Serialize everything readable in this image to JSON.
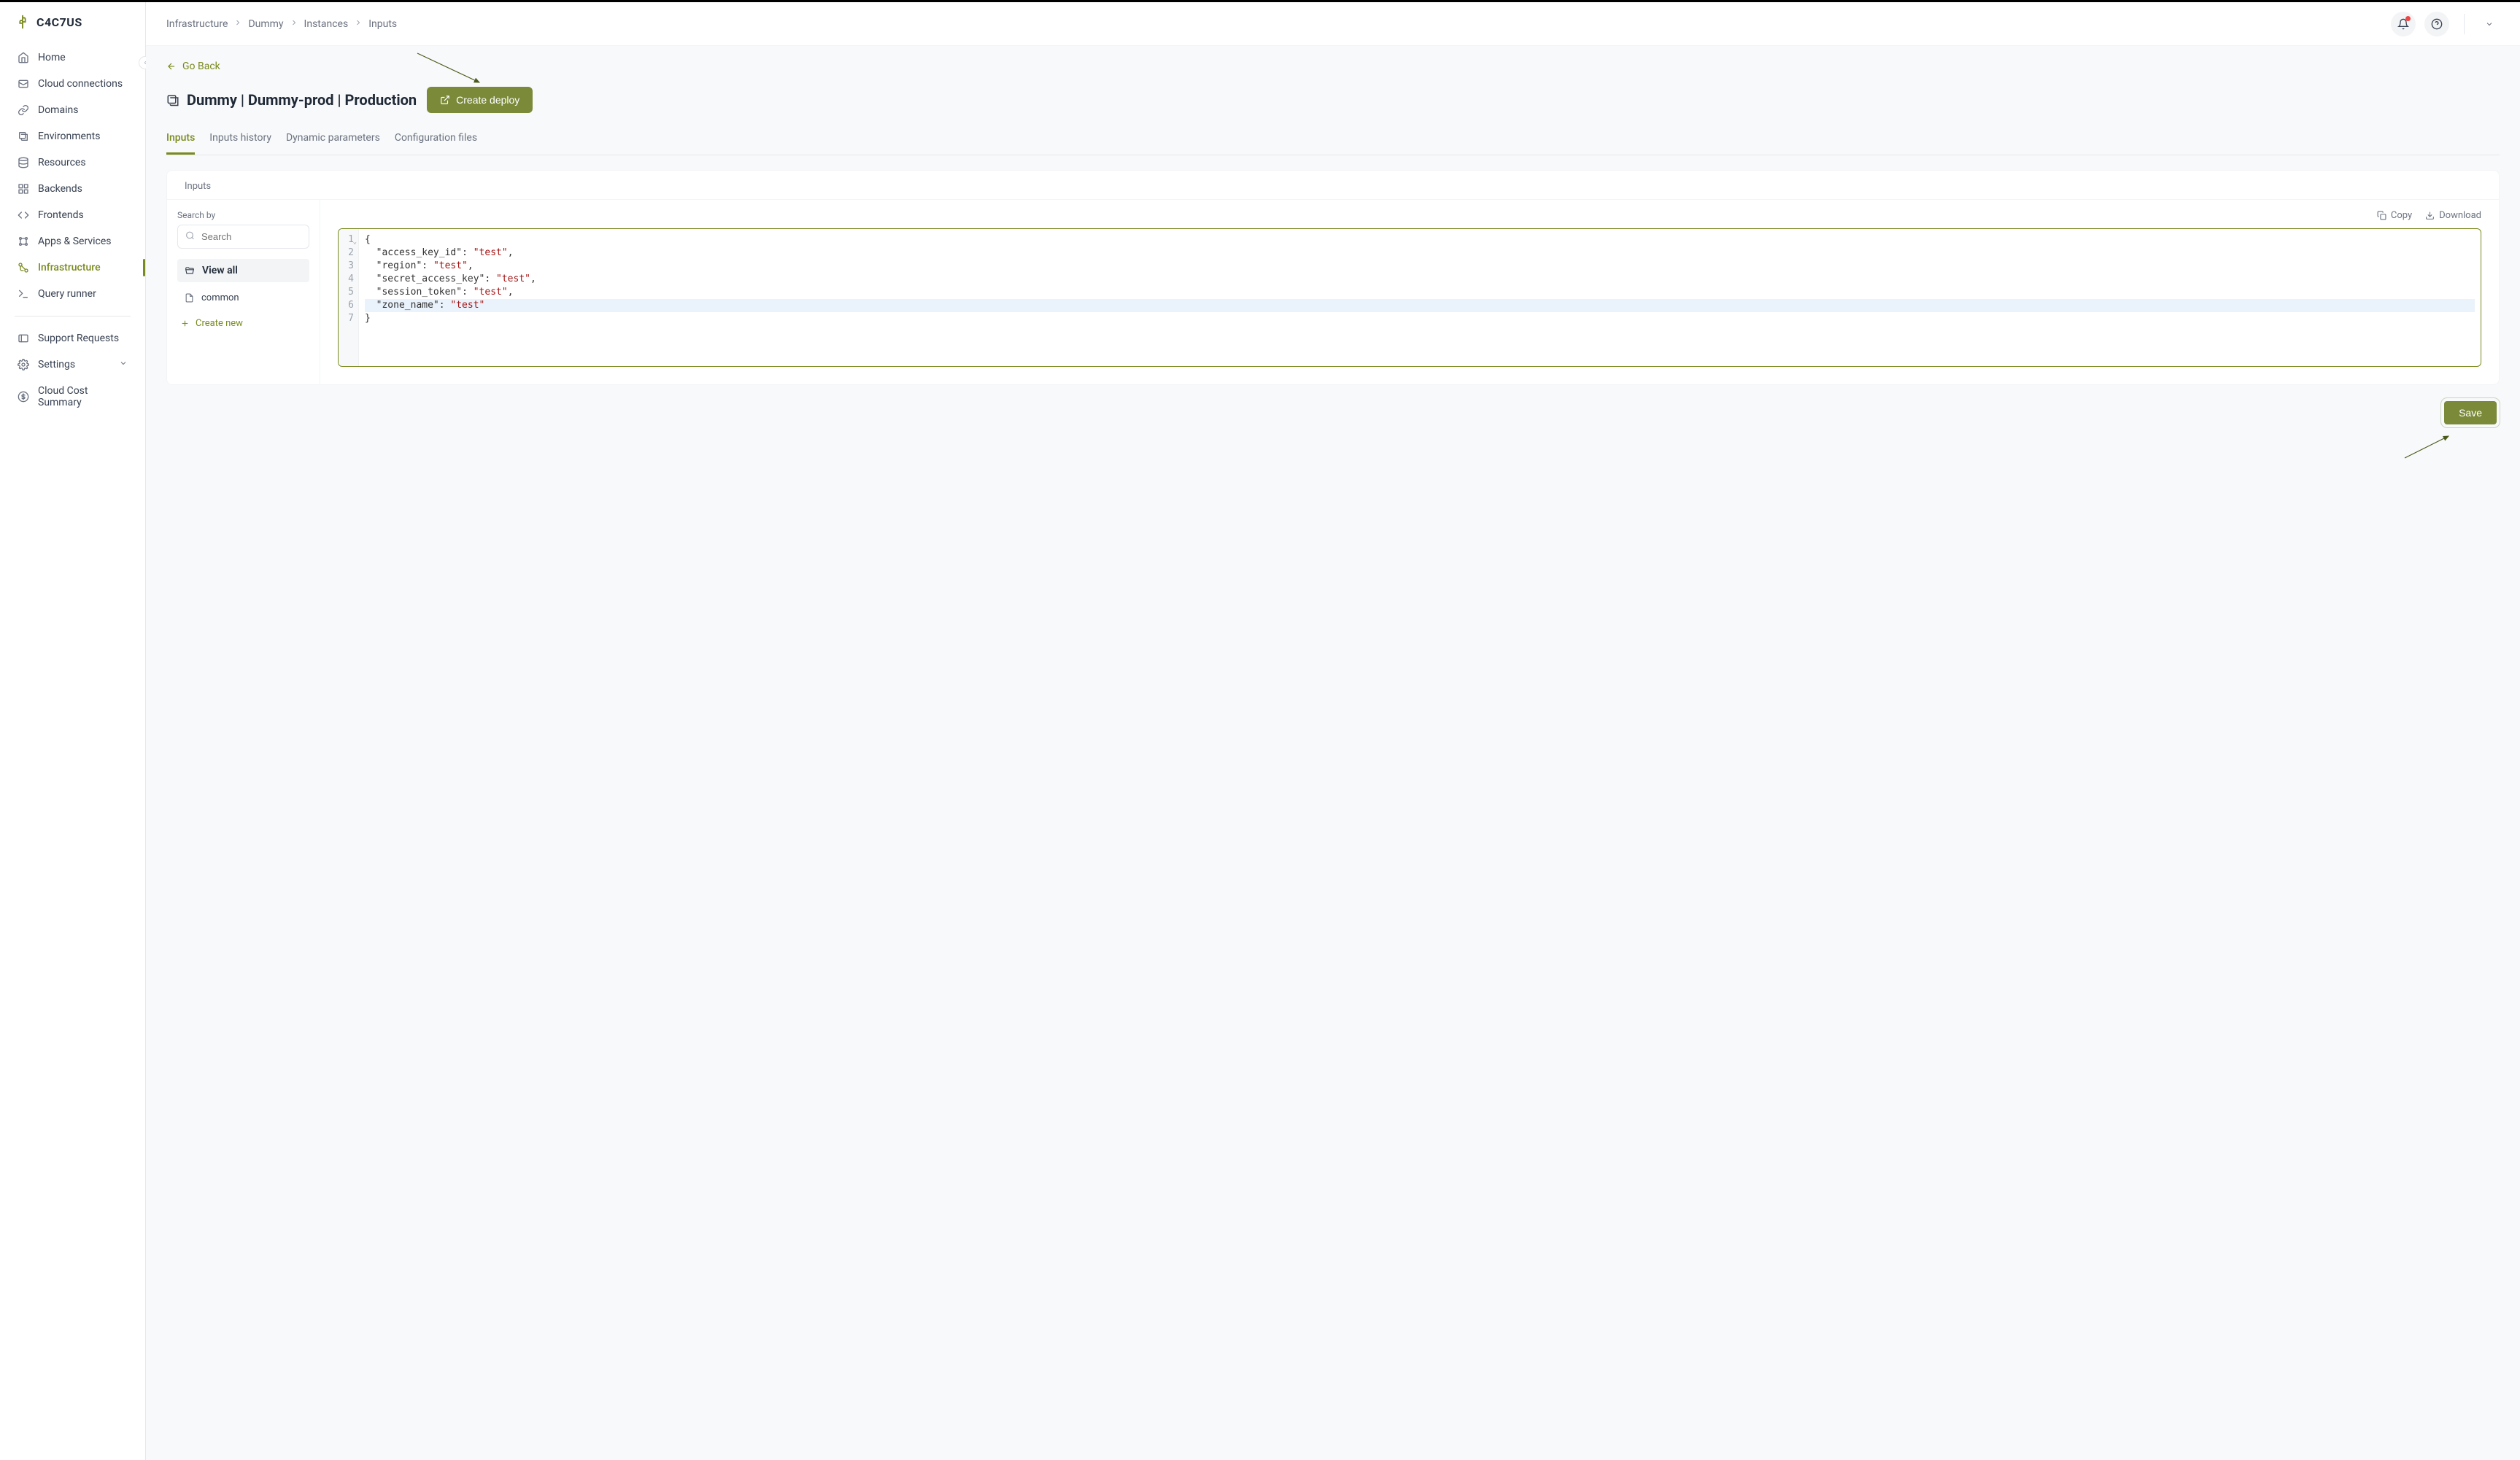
{
  "brand": "C4C7US",
  "sidebar": {
    "items": [
      {
        "label": "Home",
        "icon": "home"
      },
      {
        "label": "Cloud connections",
        "icon": "cloud"
      },
      {
        "label": "Domains",
        "icon": "link"
      },
      {
        "label": "Environments",
        "icon": "layers"
      },
      {
        "label": "Resources",
        "icon": "db"
      },
      {
        "label": "Backends",
        "icon": "grid"
      },
      {
        "label": "Frontends",
        "icon": "code"
      },
      {
        "label": "Apps & Services",
        "icon": "apps"
      },
      {
        "label": "Infrastructure",
        "icon": "infra",
        "active": true
      },
      {
        "label": "Query runner",
        "icon": "terminal"
      }
    ],
    "bottom": [
      {
        "label": "Support Requests",
        "icon": "ticket"
      },
      {
        "label": "Settings",
        "icon": "gear",
        "chevron": true
      },
      {
        "label": "Cloud Cost Summary",
        "icon": "dollar"
      }
    ]
  },
  "breadcrumb": [
    "Infrastructure",
    "Dummy",
    "Instances",
    "Inputs"
  ],
  "go_back": "Go Back",
  "page_title": "Dummy | Dummy-prod | Production",
  "create_deploy": "Create deploy",
  "tabs": [
    "Inputs",
    "Inputs history",
    "Dynamic parameters",
    "Configuration files"
  ],
  "active_tab": 0,
  "inputs_card": {
    "title": "Inputs",
    "search_label": "Search by",
    "search_placeholder": "Search",
    "view_all": "View all",
    "items": [
      "common"
    ],
    "create_new": "Create new"
  },
  "editor_toolbar": {
    "copy": "Copy",
    "download": "Download"
  },
  "code_lines": [
    {
      "n": 1,
      "fold": true,
      "tokens": [
        {
          "t": "{",
          "c": "punc"
        }
      ]
    },
    {
      "n": 2,
      "tokens": [
        {
          "t": "  ",
          "c": ""
        },
        {
          "t": "\"access_key_id\"",
          "c": "key"
        },
        {
          "t": ": ",
          "c": "punc"
        },
        {
          "t": "\"test\"",
          "c": "str"
        },
        {
          "t": ",",
          "c": "punc"
        }
      ]
    },
    {
      "n": 3,
      "tokens": [
        {
          "t": "  ",
          "c": ""
        },
        {
          "t": "\"region\"",
          "c": "key"
        },
        {
          "t": ": ",
          "c": "punc"
        },
        {
          "t": "\"test\"",
          "c": "str"
        },
        {
          "t": ",",
          "c": "punc"
        }
      ]
    },
    {
      "n": 4,
      "tokens": [
        {
          "t": "  ",
          "c": ""
        },
        {
          "t": "\"secret_access_key\"",
          "c": "key"
        },
        {
          "t": ": ",
          "c": "punc"
        },
        {
          "t": "\"test\"",
          "c": "str"
        },
        {
          "t": ",",
          "c": "punc"
        }
      ]
    },
    {
      "n": 5,
      "tokens": [
        {
          "t": "  ",
          "c": ""
        },
        {
          "t": "\"session_token\"",
          "c": "key"
        },
        {
          "t": ": ",
          "c": "punc"
        },
        {
          "t": "\"test\"",
          "c": "str"
        },
        {
          "t": ",",
          "c": "punc"
        }
      ]
    },
    {
      "n": 6,
      "hl": true,
      "tokens": [
        {
          "t": "  ",
          "c": ""
        },
        {
          "t": "\"zone_name\"",
          "c": "key"
        },
        {
          "t": ": ",
          "c": "punc"
        },
        {
          "t": "\"test\"",
          "c": "str"
        }
      ]
    },
    {
      "n": 7,
      "tokens": [
        {
          "t": "}",
          "c": "punc"
        }
      ]
    }
  ],
  "save_label": "Save"
}
